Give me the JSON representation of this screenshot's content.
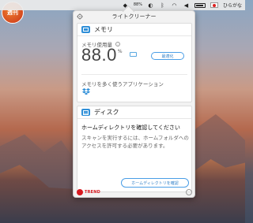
{
  "desktop": {
    "sticker_text": "週刊"
  },
  "menubar": {
    "memory_readout": "88%",
    "input_method": "ひらがな"
  },
  "window": {
    "title": "ライトクリーナー",
    "memory": {
      "heading": "メモリ",
      "usage_label": "メモリ使用量",
      "usage_value": "88.0",
      "usage_unit": "%",
      "optimize_button": "最適化",
      "apps_title": "メモリを多く使うアプリケーション"
    },
    "disk": {
      "heading": "ディスク",
      "prompt_title": "ホームディレクトリを確認してください",
      "prompt_body": "スキャンを実行するには、ホームフォルダへのアクセスを許可する必要があります。",
      "confirm_button": "ホームディレクトリを確認"
    },
    "footer": {
      "brand": "TREND"
    }
  },
  "colors": {
    "accent": "#2f8fd8",
    "brand_red": "#d71920"
  },
  "icons": [
    "gear-icon",
    "memory-icon",
    "info-icon",
    "memory-chip-icon",
    "dropbox-icon",
    "disk-icon",
    "trend-micro-logo",
    "feedback-smiley-icon",
    "battery-icon",
    "wifi-icon",
    "bluetooth-icon",
    "apple-icon"
  ]
}
